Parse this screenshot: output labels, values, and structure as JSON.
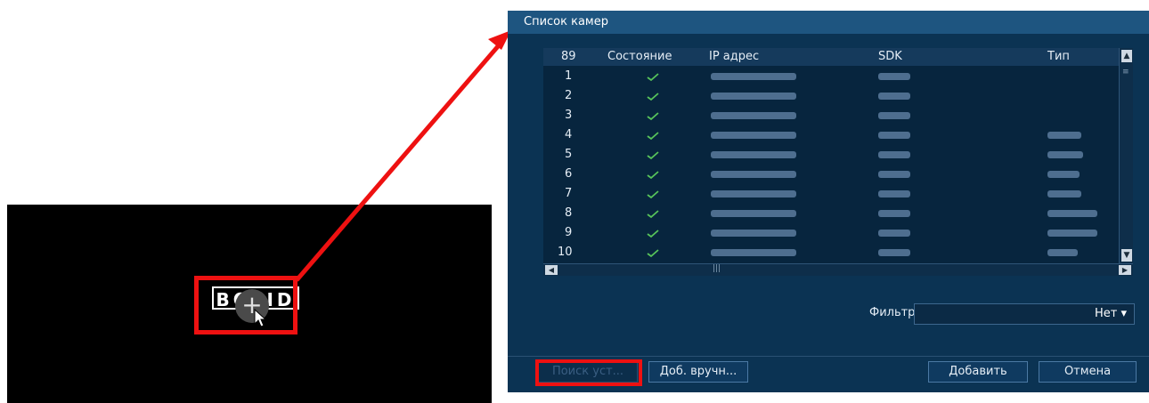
{
  "preview": {
    "logo_text": "BOLID",
    "add_icon": "plus-icon"
  },
  "dialog": {
    "title": "Список камер",
    "columns": [
      "89",
      "Состояние",
      "IP адрес",
      "SDK",
      "Тип"
    ],
    "rows": [
      {
        "num": "1",
        "status": "check-icon"
      },
      {
        "num": "2",
        "status": "check-icon"
      },
      {
        "num": "3",
        "status": "check-icon"
      },
      {
        "num": "4",
        "status": "check-icon"
      },
      {
        "num": "5",
        "status": "check-icon"
      },
      {
        "num": "6",
        "status": "check-icon"
      },
      {
        "num": "7",
        "status": "check-icon"
      },
      {
        "num": "8",
        "status": "check-icon"
      },
      {
        "num": "9",
        "status": "check-icon"
      },
      {
        "num": "10",
        "status": "check-icon"
      }
    ],
    "filter": {
      "label": "Фильтр",
      "value": "Нет"
    },
    "buttons": {
      "search": "Поиск уст...",
      "manual_add": "Доб. вручн...",
      "add": "Добавить",
      "cancel": "Отмена"
    }
  },
  "colors": {
    "highlight": "#ee1111",
    "dialog_bg": "#0b3353",
    "check": "#57c35a"
  }
}
